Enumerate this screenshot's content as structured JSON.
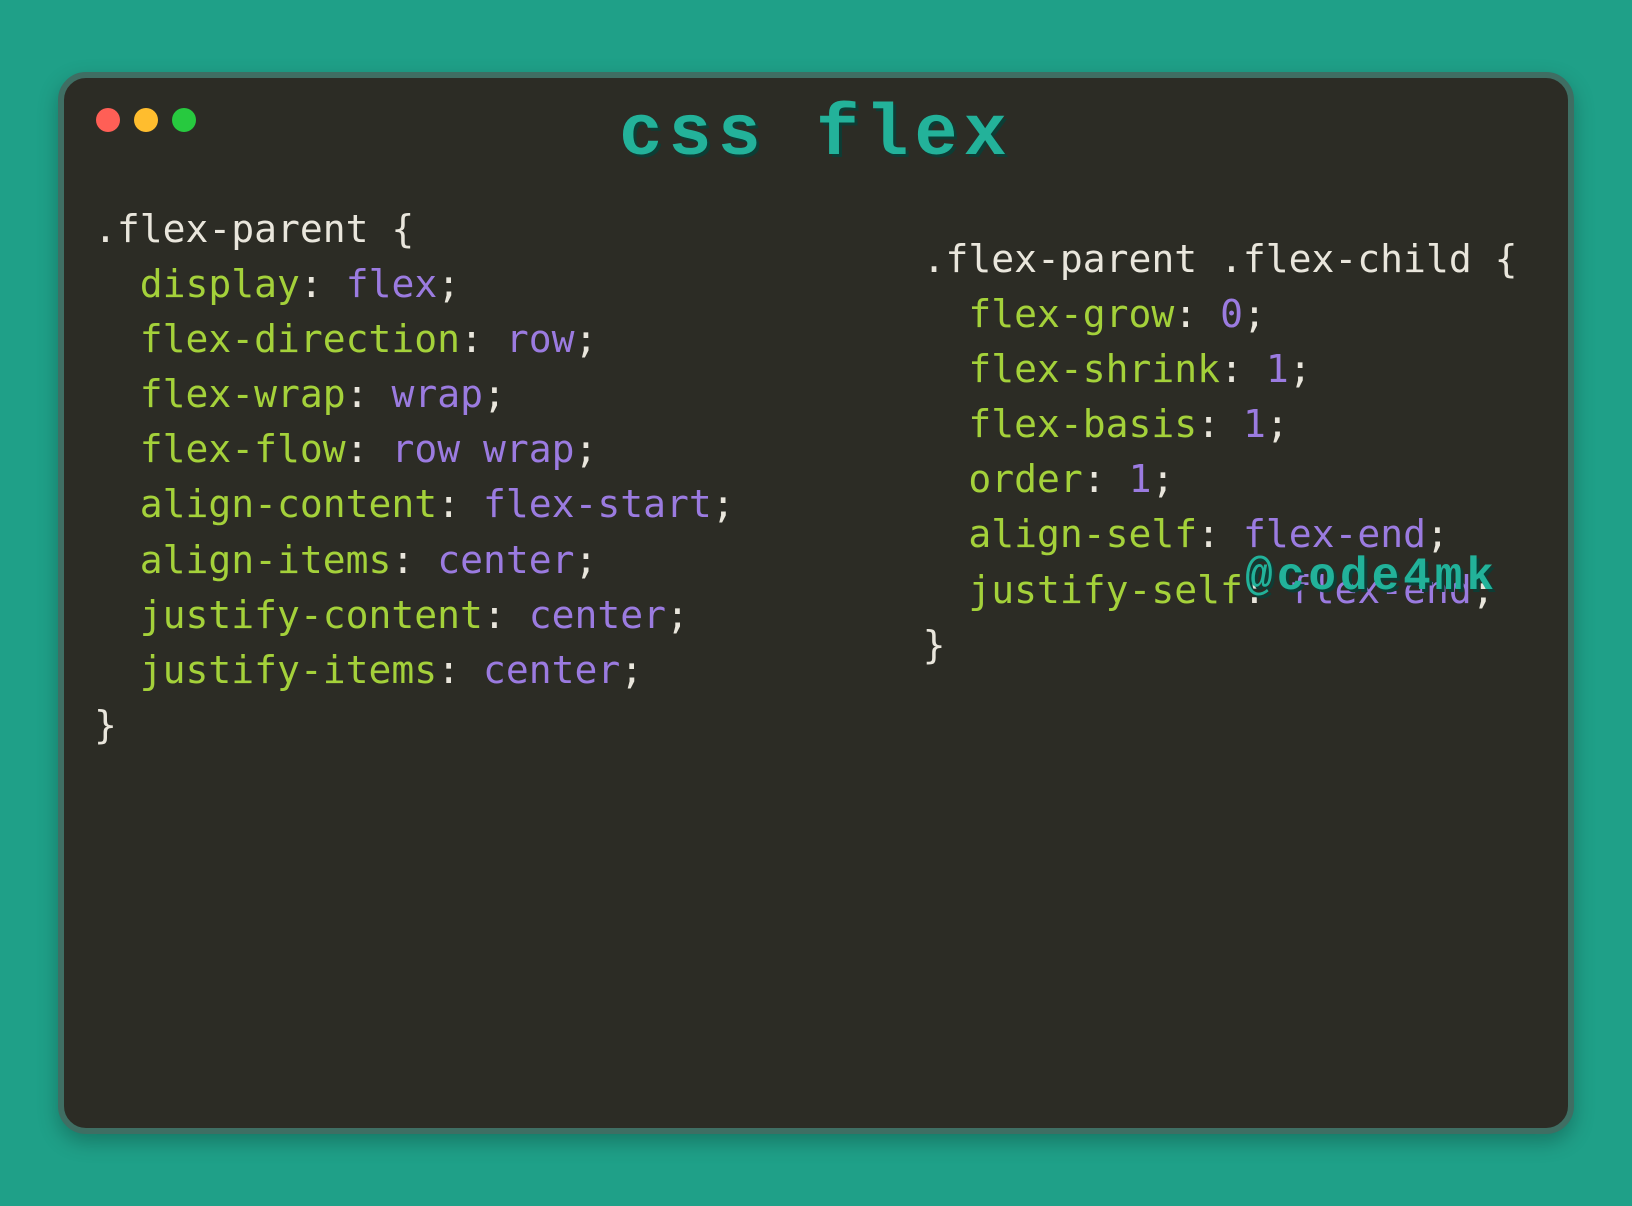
{
  "title": "css flex",
  "watermark": "@code4mk",
  "left": {
    "selector": ".flex-parent",
    "props": [
      {
        "name": "display",
        "value": "flex"
      },
      {
        "name": "flex-direction",
        "value": "row"
      },
      {
        "name": "flex-wrap",
        "value": "wrap"
      },
      {
        "name": "flex-flow",
        "value": "row wrap"
      },
      {
        "name": "align-content",
        "value": "flex-start"
      },
      {
        "name": "align-items",
        "value": "center"
      },
      {
        "name": "justify-content",
        "value": "center"
      },
      {
        "name": "justify-items",
        "value": "center"
      }
    ]
  },
  "right": {
    "selector": ".flex-parent .flex-child",
    "props": [
      {
        "name": "flex-grow",
        "value": "0"
      },
      {
        "name": "flex-shrink",
        "value": "1"
      },
      {
        "name": "flex-basis",
        "value": "1"
      },
      {
        "name": "order",
        "value": "1"
      },
      {
        "name": "align-self",
        "value": "flex-end"
      },
      {
        "name": "justify-self",
        "value": "flex-end"
      }
    ]
  },
  "colors": {
    "background": "#1fa088",
    "window": "#2c2c25",
    "accent": "#23b29a",
    "property": "#a4d13a",
    "value": "#9b7be0",
    "text": "#e9e6dc"
  }
}
